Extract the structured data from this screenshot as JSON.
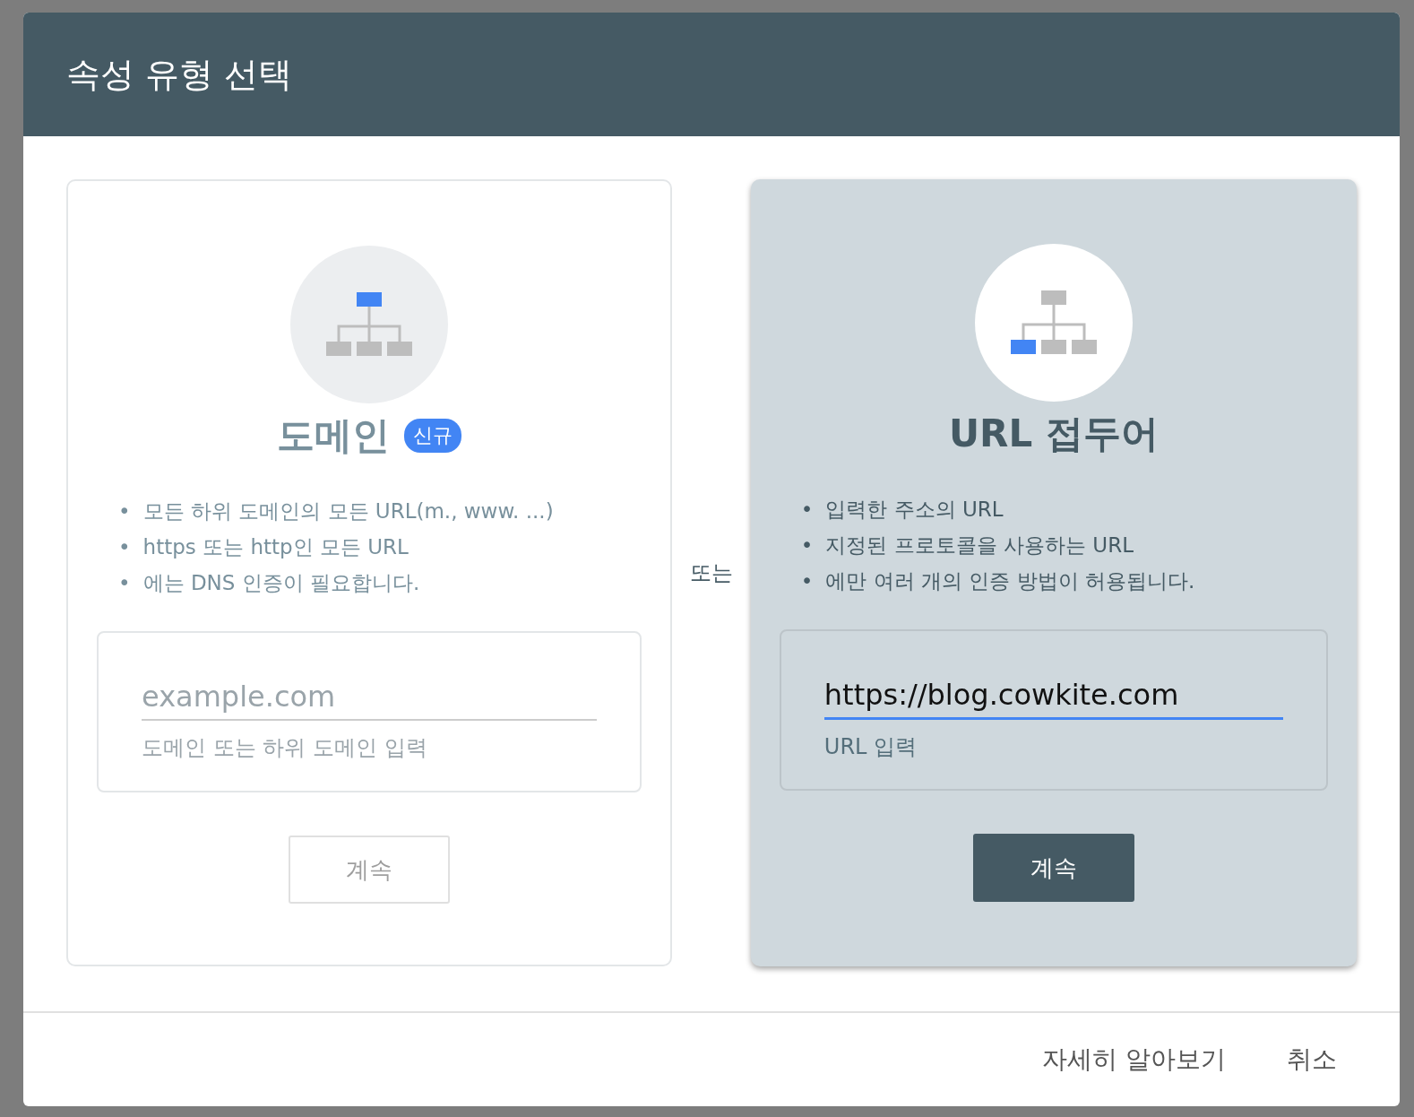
{
  "dialog": {
    "title": "속성 유형 선택",
    "options": [
      {
        "kind": "domain",
        "selected": false,
        "title": "도메인",
        "badge": "신규",
        "bullet_marker": "•",
        "bullets": [
          "모든 하위 도메인의 모든 URL(m., www. ...)",
          "https 또는 http인 모든 URL",
          "에는 DNS 인증이 필요합니다."
        ],
        "field": {
          "placeholder": "example.com",
          "focused": false,
          "helper": "도메인 또는 하위 도메인 입력"
        },
        "button": "계속"
      },
      {
        "kind": "url_prefix",
        "selected": true,
        "title": "URL 접두어",
        "bullet_marker": "•",
        "bullets": [
          "입력한 주소의 URL",
          "지정된 프로토콜을 사용하는 URL",
          "에만 여러 개의 인증 방법이 허용됩니다."
        ],
        "field": {
          "value": "https://blog.cowkite.com",
          "focused": true,
          "helper": "URL 입력"
        },
        "button": "계속"
      }
    ],
    "separator": "또는",
    "footer": {
      "links": [
        "자세히 알아보기",
        "취소"
      ]
    }
  }
}
